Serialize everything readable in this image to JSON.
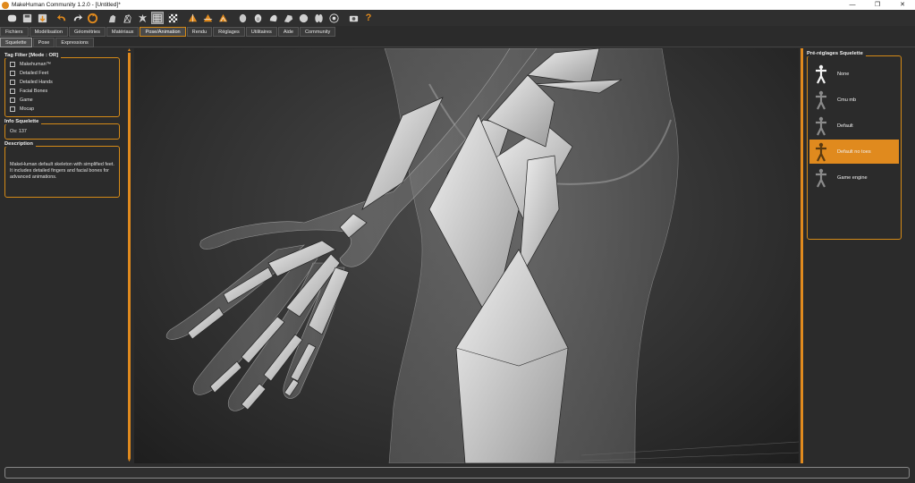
{
  "window": {
    "title": "MakeHuman Community 1.2.0 - [Untitled]*",
    "buttons": {
      "minimize": "—",
      "maximize": "❐",
      "close": "✕"
    }
  },
  "toolbar": {
    "icons": [
      "new-file-icon",
      "save-icon",
      "export-icon",
      "undo-icon",
      "redo-icon",
      "reset-icon",
      "smooth-icon",
      "wireframe-icon",
      "pose-icon",
      "grid-icon",
      "checker-icon",
      "front-view-icon",
      "side-view-icon",
      "back-view-icon",
      "head-icon",
      "face-icon",
      "hand-icon",
      "foot-icon",
      "torso-icon",
      "legs-icon",
      "globe-icon",
      "screenshot-icon",
      "help-icon"
    ],
    "active_index": 9,
    "help_glyph": "?"
  },
  "tabs": [
    {
      "label": "Fichiers"
    },
    {
      "label": "Modélisation"
    },
    {
      "label": "Géométries"
    },
    {
      "label": "Matériaux"
    },
    {
      "label": "Pose/Animation",
      "active": true
    },
    {
      "label": "Rendu"
    },
    {
      "label": "Réglages"
    },
    {
      "label": "Utilitaires"
    },
    {
      "label": "Aide"
    },
    {
      "label": "Community"
    }
  ],
  "subtabs": [
    {
      "label": "Squelette",
      "active": true
    },
    {
      "label": "Pose"
    },
    {
      "label": "Expressions"
    }
  ],
  "left": {
    "tag_filter": {
      "title": "Tag Filter [Mode : OR]",
      "items": [
        "Makehuman™",
        "Detailed Feet",
        "Detailed Hands",
        "Facial Bones",
        "Game",
        "Mocap"
      ]
    },
    "info": {
      "title": "Info Squelette",
      "bones": "Os: 137"
    },
    "description": {
      "title": "Description",
      "text": "MakeHuman default skeleton with simplified feet. It includes detailed fingers and facial bones for advanced animations."
    }
  },
  "right": {
    "title": "Pré-réglages Squelette",
    "presets": [
      {
        "label": "None",
        "selected": false
      },
      {
        "label": "Cmu mb",
        "selected": false
      },
      {
        "label": "Default",
        "selected": false
      },
      {
        "label": "Default no toes",
        "selected": true
      },
      {
        "label": "Game engine",
        "selected": false
      }
    ]
  },
  "colors": {
    "accent": "#e08a1e",
    "panel": "#2b2b2b",
    "selected_preset": "#e08a1e"
  }
}
